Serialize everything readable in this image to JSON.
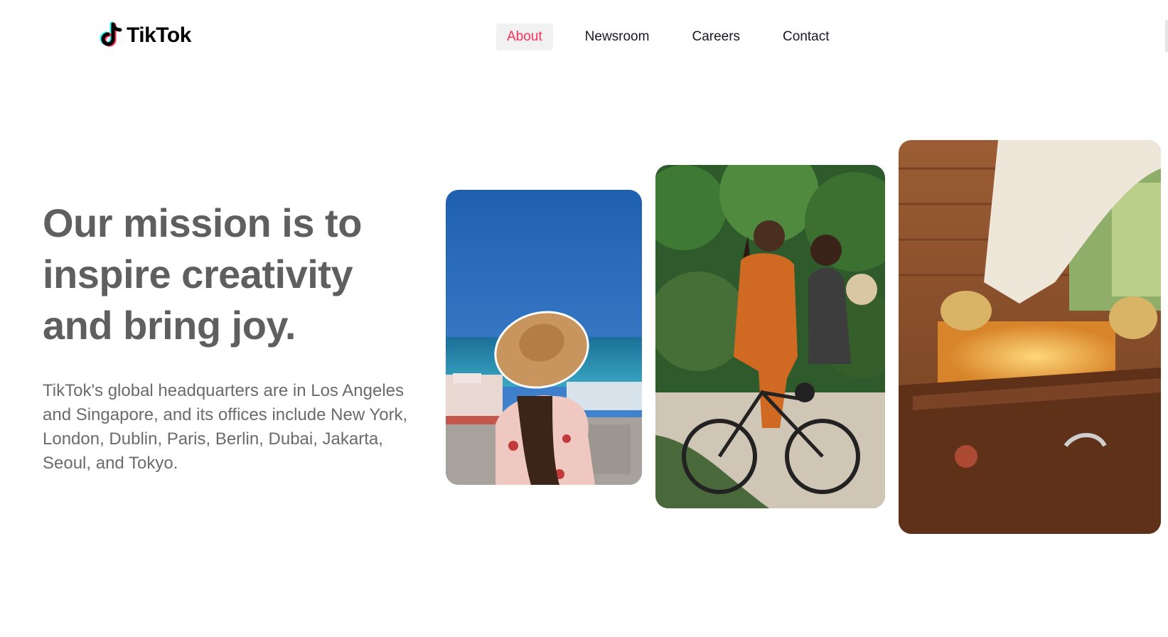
{
  "brand": {
    "name": "TikTok"
  },
  "nav": {
    "items": [
      {
        "label": "About",
        "active": true
      },
      {
        "label": "Newsroom",
        "active": false
      },
      {
        "label": "Careers",
        "active": false
      },
      {
        "label": "Contact",
        "active": false
      }
    ]
  },
  "hero": {
    "title": "Our mission is to inspire creativity and bring joy.",
    "body": "TikTok's global headquarters are in Los Angeles and Singapore, and its offices include New York, London, Dublin, Paris, Berlin, Dubai, Jakarta, Seoul, and Tokyo."
  },
  "gallery": {
    "images": [
      {
        "name": "woman-sun-hat-sea-photo"
      },
      {
        "name": "women-cycling-photo"
      },
      {
        "name": "beekeeper-hive-photo"
      }
    ]
  },
  "colors": {
    "accent": "#fe2c55",
    "title_text": "#5f5f5f",
    "body_text": "#6b6b6b",
    "active_tab_bg": "#f1f1f2",
    "logo_cyan": "#25f4ee"
  }
}
